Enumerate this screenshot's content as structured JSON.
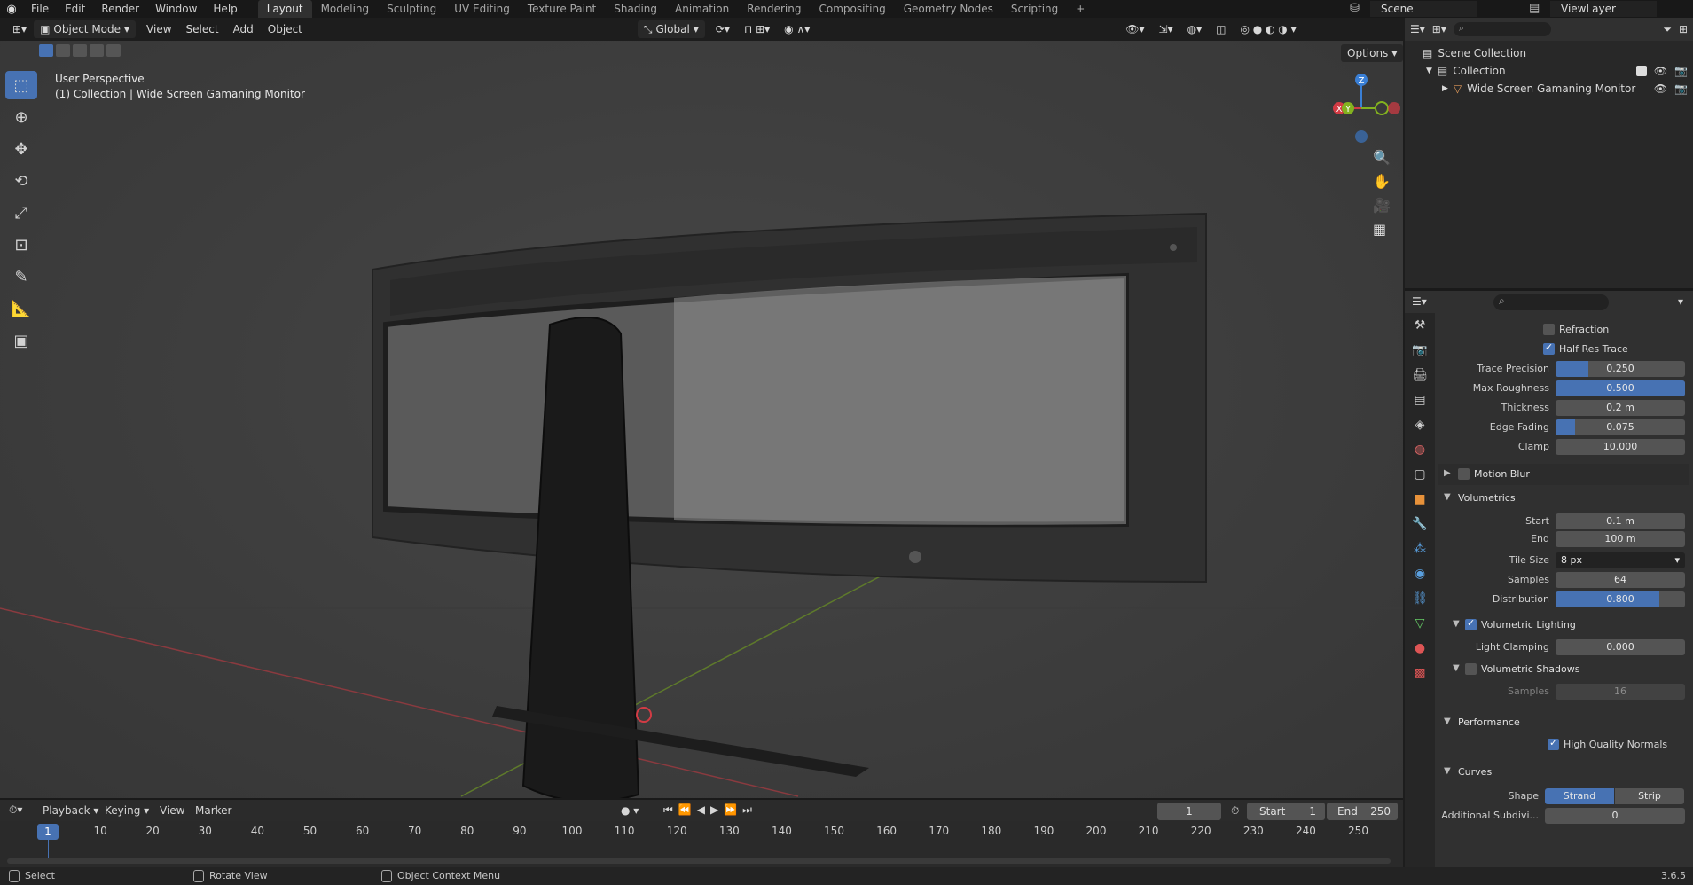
{
  "topbar": {
    "menus": [
      "File",
      "Edit",
      "Render",
      "Window",
      "Help"
    ],
    "workspaces": [
      "Layout",
      "Modeling",
      "Sculpting",
      "UV Editing",
      "Texture Paint",
      "Shading",
      "Animation",
      "Rendering",
      "Compositing",
      "Geometry Nodes",
      "Scripting"
    ],
    "active_workspace": "Layout",
    "add_tab": "+",
    "scene": "Scene",
    "view_layer": "ViewLayer"
  },
  "viewport_header": {
    "mode": "Object Mode",
    "menus": [
      "View",
      "Select",
      "Add",
      "Object"
    ],
    "orientation": "Global",
    "options": "Options"
  },
  "viewport": {
    "perspective": "User Perspective",
    "collection_line": "(1) Collection | Wide Screen Gamaning Monitor",
    "gizmo_z": "Z",
    "gizmo_y": "Y",
    "gizmo_x": "X"
  },
  "outliner": {
    "scene_collection": "Scene Collection",
    "collection": "Collection",
    "object": "Wide Screen Gamaning Monitor"
  },
  "properties": {
    "refraction": {
      "label": "Refraction",
      "checked": false
    },
    "half_res_trace": {
      "label": "Half Res Trace",
      "checked": true
    },
    "trace_precision": {
      "label": "Trace Precision",
      "value": "0.250",
      "fraction": 0.25
    },
    "max_roughness": {
      "label": "Max Roughness",
      "value": "0.500",
      "fraction": 1.0
    },
    "thickness": {
      "label": "Thickness",
      "value": "0.2 m"
    },
    "edge_fading": {
      "label": "Edge Fading",
      "value": "0.075",
      "fraction": 0.15
    },
    "clamp": {
      "label": "Clamp",
      "value": "10.000"
    },
    "motion_blur": "Motion Blur",
    "volumetrics": "Volumetrics",
    "start": {
      "label": "Start",
      "value": "0.1 m"
    },
    "end": {
      "label": "End",
      "value": "100 m"
    },
    "tile_size": {
      "label": "Tile Size",
      "value": "8 px"
    },
    "samples": {
      "label": "Samples",
      "value": "64"
    },
    "distribution": {
      "label": "Distribution",
      "value": "0.800",
      "fraction": 0.8
    },
    "volumetric_lighting": "Volumetric Lighting",
    "light_clamping": {
      "label": "Light Clamping",
      "value": "0.000"
    },
    "volumetric_shadows": "Volumetric Shadows",
    "shadow_samples": {
      "label": "Samples",
      "value": "16"
    },
    "performance": "Performance",
    "high_quality_normals": "High Quality Normals",
    "curves": "Curves",
    "shape": {
      "label": "Shape",
      "opt1": "Strand",
      "opt2": "Strip"
    },
    "additional_subdiv": {
      "label": "Additional Subdivi...",
      "value": "0"
    }
  },
  "timeline": {
    "menus": [
      "Playback",
      "Keying",
      "View",
      "Marker"
    ],
    "current_frame": "1",
    "start_label": "Start",
    "start": "1",
    "end_label": "End",
    "end": "250",
    "ticks": [
      "10",
      "20",
      "30",
      "40",
      "50",
      "60",
      "70",
      "80",
      "90",
      "100",
      "110",
      "120",
      "130",
      "140",
      "150",
      "160",
      "170",
      "180",
      "190",
      "200",
      "210",
      "220",
      "230",
      "240",
      "250"
    ],
    "cursor_frame": "1"
  },
  "statusbar": {
    "select": "Select",
    "rotate": "Rotate View",
    "context": "Object Context Menu",
    "version": "3.6.5"
  },
  "colors": {
    "accent": "#4772b3",
    "x_axis": "#d23b44",
    "y_axis": "#83b21f",
    "z_axis": "#3a7fd5"
  }
}
